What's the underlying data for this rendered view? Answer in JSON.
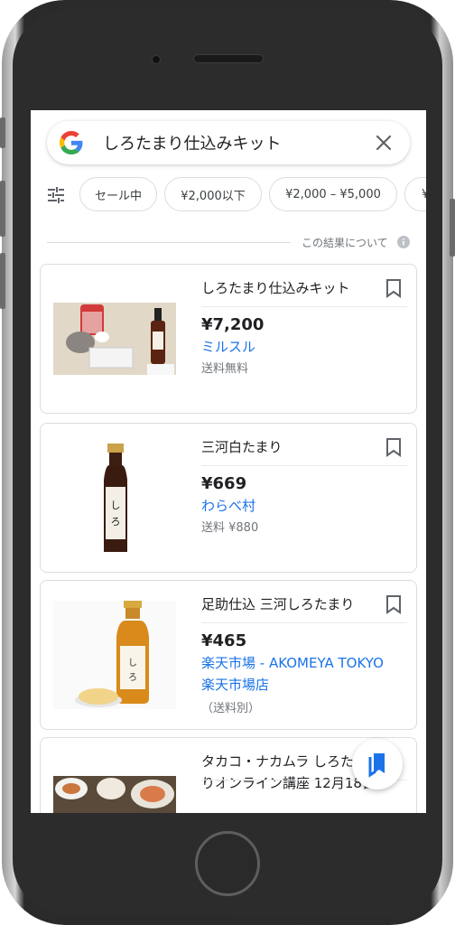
{
  "search": {
    "query": "しろたまり仕込みキット"
  },
  "filters": {
    "chips": [
      "セール中",
      "¥2,000以下",
      "¥2,000 – ¥5,000",
      "¥"
    ]
  },
  "about_results": "この結果について",
  "products": [
    {
      "title": "しろたまり仕込みキット",
      "price": "¥7,200",
      "seller": "ミルスル",
      "seller2": "",
      "shipping": "送料無料"
    },
    {
      "title": "三河白たまり",
      "price": "¥669",
      "seller": "わらべ村",
      "seller2": "",
      "shipping": "送料 ¥880"
    },
    {
      "title": "足助仕込 三河しろたまり",
      "price": "¥465",
      "seller": "楽天市場 - AKOMEYA TOKYO",
      "seller2": "楽天市場店",
      "shipping": "（送料別）"
    },
    {
      "title": "タカコ・ナカムラ しろたまりオンライン講座 12月18日",
      "price": "",
      "seller": "",
      "seller2": "",
      "shipping": ""
    }
  ],
  "colors": {
    "link": "#1a73e8",
    "text": "#202124",
    "muted": "#70757a",
    "border": "#dadce0",
    "frame": "#2c2c2c"
  }
}
